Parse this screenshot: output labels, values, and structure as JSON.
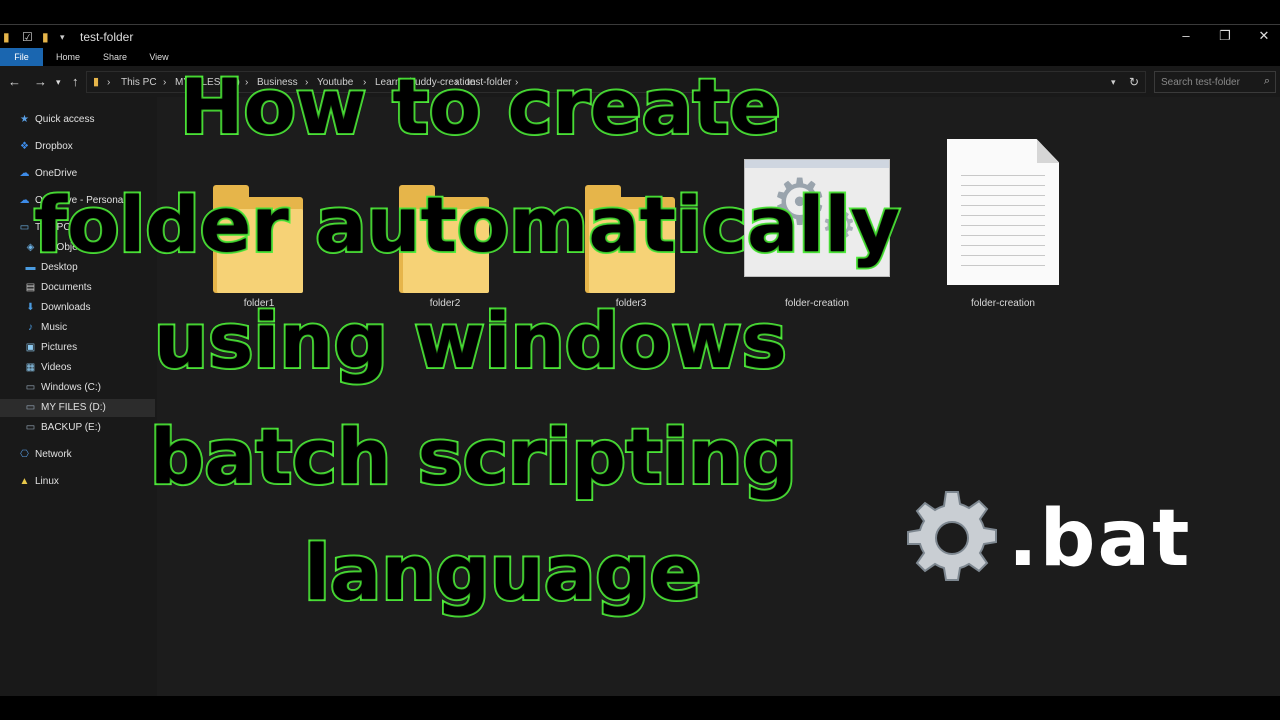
{
  "window": {
    "title": "test-folder",
    "ribbon_tabs": [
      "File",
      "Home",
      "Share",
      "View"
    ]
  },
  "address": {
    "breadcrumbs": [
      "This PC",
      "MY FILES (D:)",
      "Business",
      "Youtube",
      "Learnerbuddy-creation",
      "test-folder"
    ],
    "search_placeholder": "Search test-folder"
  },
  "nav": {
    "items": [
      {
        "label": "Quick access",
        "icon": "star-icon"
      },
      {
        "label": "Dropbox",
        "icon": "dropbox-icon"
      },
      {
        "label": "OneDrive",
        "icon": "cloud-icon"
      },
      {
        "label": "OneDrive - Personal",
        "icon": "cloud-icon"
      },
      {
        "label": "This PC",
        "icon": "computer-icon"
      },
      {
        "label": "3D Objects",
        "icon": "cube-icon"
      },
      {
        "label": "Desktop",
        "icon": "desktop-icon"
      },
      {
        "label": "Documents",
        "icon": "document-icon"
      },
      {
        "label": "Downloads",
        "icon": "download-icon"
      },
      {
        "label": "Music",
        "icon": "music-icon"
      },
      {
        "label": "Pictures",
        "icon": "picture-icon"
      },
      {
        "label": "Videos",
        "icon": "video-icon"
      },
      {
        "label": "Windows (C:)",
        "icon": "drive-icon"
      },
      {
        "label": "MY FILES (D:)",
        "icon": "drive-icon"
      },
      {
        "label": "BACKUP (E:)",
        "icon": "drive-icon"
      },
      {
        "label": "Network",
        "icon": "network-icon"
      },
      {
        "label": "Linux",
        "icon": "linux-icon"
      }
    ]
  },
  "files": [
    {
      "name": "folder1",
      "type": "folder"
    },
    {
      "name": "folder2",
      "type": "folder"
    },
    {
      "name": "folder3",
      "type": "folder"
    },
    {
      "name": "folder-creation",
      "type": "batch-file"
    },
    {
      "name": "folder-creation",
      "type": "text-document"
    }
  ],
  "overlay": {
    "lines": [
      "How to create",
      "folder automatically",
      "using windows",
      "batch scripting",
      "language"
    ],
    "extension_label": ".bat",
    "text_outline_color": "#52f23d",
    "text_fill_color": "#000000"
  }
}
